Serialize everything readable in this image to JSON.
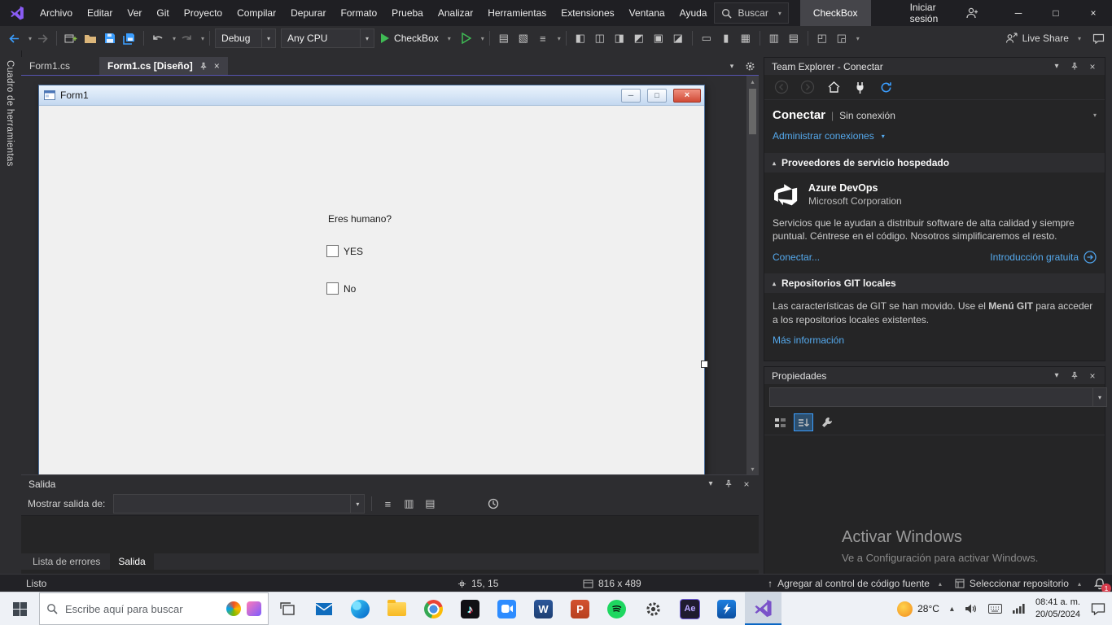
{
  "colors": {
    "accent_blue": "#3b9eff",
    "run_green": "#3fba54",
    "close_red": "#d14a36",
    "vs_purple": "#8a5cf5",
    "link_blue": "#55aaee",
    "taskbar_light": "#eef1f6"
  },
  "icons": {
    "chevron_down": "▾",
    "chevron_up": "▴",
    "close": "×",
    "minimize": "─",
    "maximize": "□",
    "separator_bar": "|",
    "section_marker": "▴",
    "up_arrow": "↑",
    "music_note": "♪",
    "align_lefts": "◧",
    "align_centers": "◫",
    "align_rights": "◨",
    "align_tops": "◩",
    "align_middles": "▣",
    "align_bottoms": "◪",
    "same_width": "▭",
    "same_height": "▮",
    "same_size": "▦",
    "h_spacing": "▥",
    "v_spacing": "▤",
    "bring_front": "◰",
    "send_back": "◲",
    "window_glyph": "▧",
    "list_glyph": "≡",
    "word_logo": "W",
    "powerpoint_logo": "P",
    "after_effects_logo": "Ae"
  },
  "title_bar": {
    "menus": [
      "Archivo",
      "Editar",
      "Ver",
      "Git",
      "Proyecto",
      "Compilar",
      "Depurar",
      "Formato",
      "Prueba",
      "Analizar",
      "Herramientas",
      "Extensiones",
      "Ventana",
      "Ayuda"
    ],
    "search_label": "Buscar",
    "solution_name": "CheckBox",
    "sign_in_label": "Iniciar sesión"
  },
  "toolbar": {
    "configuration": "Debug",
    "platform": "Any CPU",
    "run_target": "CheckBox",
    "live_share_label": "Live Share"
  },
  "toolbox_strip": {
    "label": "Cuadro de herramientas"
  },
  "editor": {
    "tabs": [
      "Form1.cs",
      "Form1.cs [Diseño]"
    ],
    "form": {
      "title": "Form1",
      "question": "Eres humano?",
      "checkbox_yes": "YES",
      "checkbox_no": "No"
    }
  },
  "output_panel": {
    "title": "Salida",
    "show_output_from_label": "Mostrar salida de:",
    "combo_value": "",
    "tabs": {
      "error_list": "Lista de errores",
      "output": "Salida"
    }
  },
  "team_explorer": {
    "title": "Team Explorer - Conectar",
    "page_title": "Conectar",
    "connection_status": "Sin conexión",
    "manage_connections_label": "Administrar conexiones",
    "hosted_providers_header": "Proveedores de servicio hospedado",
    "azure_devops": {
      "name": "Azure DevOps",
      "vendor": "Microsoft Corporation",
      "description": "Servicios que le ayudan a distribuir software de alta calidad y siempre puntual. Céntrese en el código. Nosotros simplificaremos el resto.",
      "connect_link": "Conectar...",
      "free_intro_link": "Introducción gratuita"
    },
    "local_git_header": "Repositorios GIT locales",
    "git_moved_text_1": "Las características de GIT se han movido. Use el ",
    "git_moved_bold": "Menú GIT",
    "git_moved_text_2": " para acceder a los repositorios locales existentes.",
    "more_info_link": "Más información"
  },
  "properties_panel": {
    "title": "Propiedades",
    "selector_value": ""
  },
  "activation_watermark": {
    "line1": "Activar Windows",
    "line2": "Ve a Configuración para activar Windows."
  },
  "status_bar": {
    "state": "Listo",
    "cursor_position": "15, 15",
    "form_size": "816 x 489",
    "add_to_source_control_label": "Agregar al control de código fuente",
    "select_repository_label": "Seleccionar repositorio",
    "notifications_count": "1"
  },
  "taskbar": {
    "search_placeholder": "Escribe aquí para buscar",
    "weather_temp": "28°C",
    "clock_time": "08:41 a. m.",
    "clock_date": "20/05/2024"
  }
}
